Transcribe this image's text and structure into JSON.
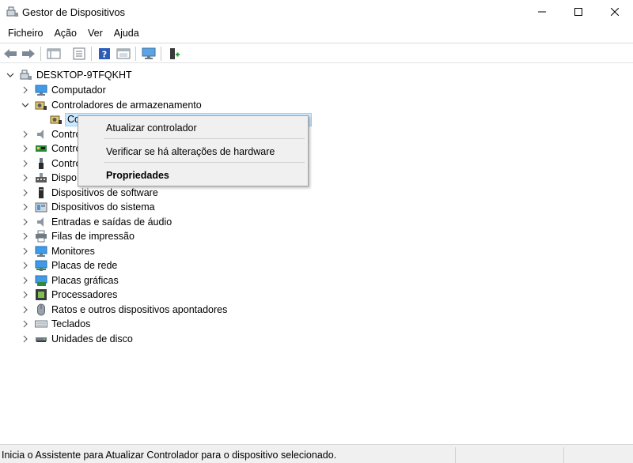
{
  "window": {
    "title": "Gestor de Dispositivos",
    "controls": [
      "minimize-icon",
      "maximize-icon",
      "close-icon"
    ]
  },
  "menubar": {
    "items": [
      "Ficheiro",
      "Ação",
      "Ver",
      "Ajuda"
    ]
  },
  "toolbar": {
    "buttons": [
      "back-arrow-icon",
      "forward-arrow-icon",
      "device-list-view-icon",
      "properties-icon",
      "help-icon",
      "update-driver-view-icon",
      "scan-monitor-icon",
      "add-driver-icon"
    ]
  },
  "tree": {
    "root": "DESKTOP-9TFQKHT",
    "items": [
      {
        "label": "Computador",
        "icon": "computer-icon"
      },
      {
        "label": "Controladores de armazenamento",
        "icon": "storage-controller-icon",
        "expanded": true
      },
      {
        "label": "Co",
        "icon": "storage-device-icon",
        "selected": true
      },
      {
        "label": "Contro",
        "icon": "audio-controller-icon"
      },
      {
        "label": "Contro",
        "icon": "network-card-icon"
      },
      {
        "label": "Contro",
        "icon": "usb-controller-icon"
      },
      {
        "label": "Dispo",
        "icon": "hid-device-icon"
      },
      {
        "label": "Dispositivos de software",
        "icon": "software-device-icon"
      },
      {
        "label": "Dispositivos do sistema",
        "icon": "system-device-icon"
      },
      {
        "label": "Entradas e saídas de áudio",
        "icon": "speaker-icon"
      },
      {
        "label": "Filas de impressão",
        "icon": "printer-icon"
      },
      {
        "label": "Monitores",
        "icon": "monitor-icon"
      },
      {
        "label": "Placas de rede",
        "icon": "network-adapter-icon"
      },
      {
        "label": "Placas gráficas",
        "icon": "graphics-card-icon"
      },
      {
        "label": "Processadores",
        "icon": "processor-icon"
      },
      {
        "label": "Ratos e outros dispositivos apontadores",
        "icon": "mouse-icon"
      },
      {
        "label": "Teclados",
        "icon": "keyboard-icon"
      },
      {
        "label": "Unidades de disco",
        "icon": "disk-drive-icon"
      }
    ]
  },
  "context_menu": {
    "update_driver": "Atualizar controlador",
    "scan_hardware": "Verificar se há alterações de hardware",
    "properties": "Propriedades"
  },
  "statusbar": {
    "text": "Inicia o Assistente para Atualizar Controlador para o dispositivo selecionado."
  },
  "colors": {
    "selection": "#cce8ff",
    "selection_border": "#99d1ff",
    "menu_bg": "#f0f0f0",
    "accent_blue": "#1e6fd9"
  }
}
